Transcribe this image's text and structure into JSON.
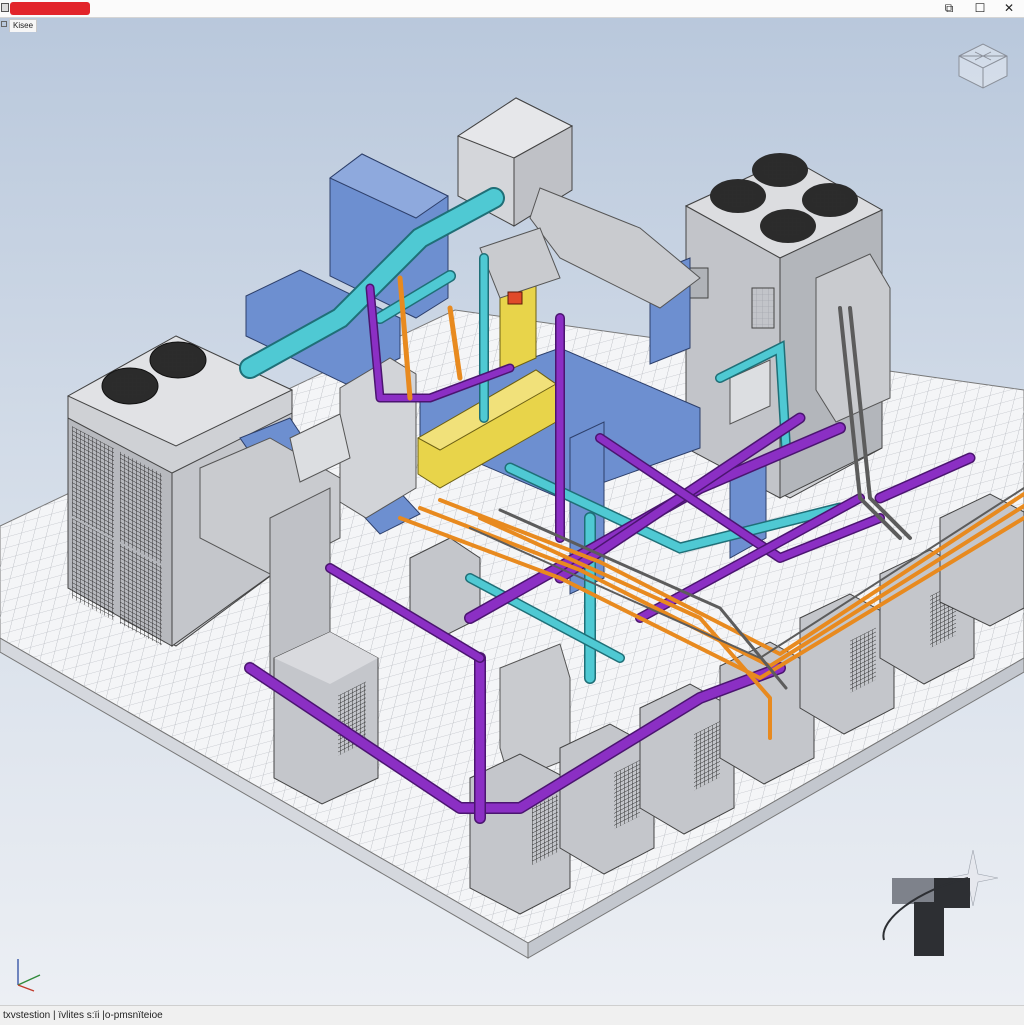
{
  "window": {
    "title": "",
    "controls": {
      "restore_glyph": "⧉",
      "maximize_glyph": "☐",
      "close_glyph": "✕"
    }
  },
  "tabs": [
    {
      "label": "Kisee"
    }
  ],
  "status_bar": {
    "text": "txvstestion | ïvlites s:ïi |o-pmsnïteioe"
  },
  "colors": {
    "ducts_blue": "#6d8fd0",
    "pipes_cyan": "#4fc9d3",
    "pipes_purple": "#8b2fc4",
    "pipes_orange": "#e88a1f",
    "ducts_yellow": "#e8d44a",
    "equipment_grey": "#c9cbcf",
    "floor_grid": "#f4f5f7",
    "title_highlight": "#e2242a"
  },
  "icons": {
    "viewcube": "viewcube-icon",
    "axis_triad": "axis-triad-icon",
    "logo": "app-logo-icon"
  }
}
